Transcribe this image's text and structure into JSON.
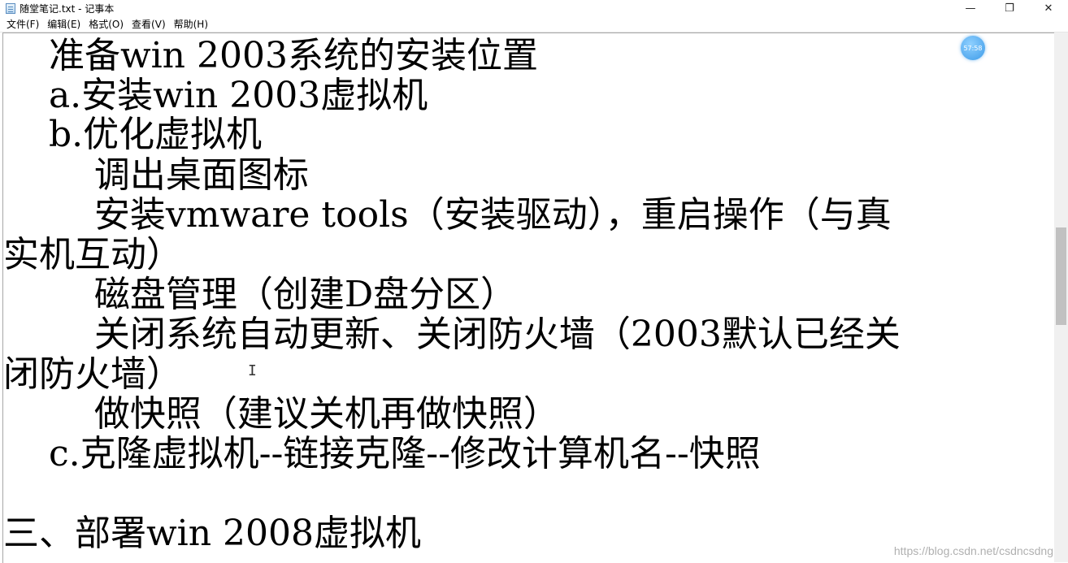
{
  "window": {
    "title": "随堂笔记.txt - 记事本",
    "minimize_glyph": "—",
    "restore_glyph": "❐",
    "close_glyph": "✕"
  },
  "menu": {
    "file": "文件(F)",
    "edit": "编辑(E)",
    "format": "格式(O)",
    "view": "查看(V)",
    "help": "帮助(H)"
  },
  "document": {
    "lines": [
      "    准备win 2003系统的安装位置",
      "    a.安装win 2003虚拟机",
      "    b.优化虚拟机",
      "        调出桌面图标",
      "        安装vmware tools（安装驱动），重启操作（与真",
      "实机互动）",
      "        磁盘管理（创建D盘分区）",
      "        关闭系统自动更新、关闭防火墙（2003默认已经关",
      "闭防火墙）",
      "        做快照（建议关机再做快照）",
      "    c.克隆虚拟机--链接克隆--修改计算机名--快照",
      "",
      "三、部署win 2008虚拟机"
    ]
  },
  "overlay": {
    "timer": "57:58",
    "cursor_glyph": "I",
    "watermark": "https://blog.csdn.net/csdncsdng"
  }
}
